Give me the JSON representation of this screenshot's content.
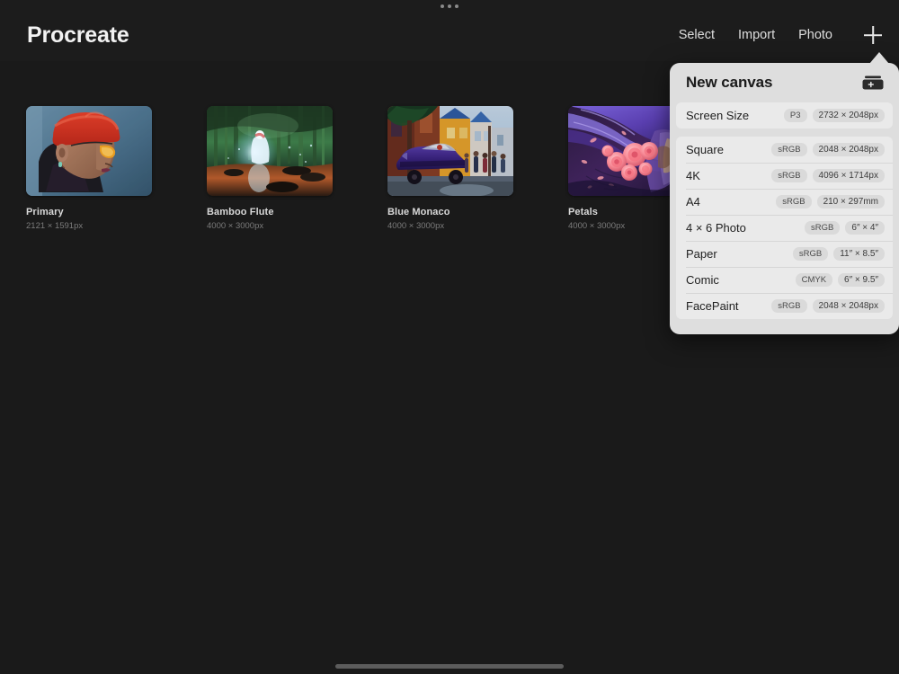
{
  "app": {
    "title": "Procreate",
    "multitask_dots": 3
  },
  "nav": {
    "items": [
      {
        "label": "Select",
        "name": "select"
      },
      {
        "label": "Import",
        "name": "import"
      },
      {
        "label": "Photo",
        "name": "photo"
      }
    ],
    "add_icon": "plus-icon"
  },
  "gallery": {
    "artworks": [
      {
        "title": "Primary",
        "dimensions": "2121 × 1591px",
        "art": "portrait-red-beanie"
      },
      {
        "title": "Bamboo Flute",
        "dimensions": "4000 × 3000px",
        "art": "bamboo-forest-spirit"
      },
      {
        "title": "Blue Monaco",
        "dimensions": "4000 × 3000px",
        "art": "purple-car-street"
      },
      {
        "title": "Petals",
        "dimensions": "4000 × 3000px",
        "art": "purple-hair-roses"
      }
    ]
  },
  "popover": {
    "title": "New canvas",
    "custom_canvas_icon": "canvas-plus-icon",
    "groups": [
      {
        "rows": [
          {
            "name": "Screen Size",
            "color_profile": "P3",
            "size": "2732 × 2048px"
          }
        ]
      },
      {
        "rows": [
          {
            "name": "Square",
            "color_profile": "sRGB",
            "size": "2048 × 2048px"
          },
          {
            "name": "4K",
            "color_profile": "sRGB",
            "size": "4096 × 1714px"
          },
          {
            "name": "A4",
            "color_profile": "sRGB",
            "size": "210 × 297mm"
          },
          {
            "name": "4 × 6 Photo",
            "color_profile": "sRGB",
            "size": "6″ × 4″"
          },
          {
            "name": "Paper",
            "color_profile": "sRGB",
            "size": "11″ × 8.5″"
          },
          {
            "name": "Comic",
            "color_profile": "CMYK",
            "size": "6″ × 9.5″"
          },
          {
            "name": "FacePaint",
            "color_profile": "sRGB",
            "size": "2048 × 2048px"
          }
        ]
      }
    ]
  },
  "system": {
    "home_indicator": "home-indicator"
  },
  "colors": {
    "background": "#1a1a1a",
    "topbar": "#1c1c1c",
    "popover_bg": "#dedede",
    "popover_row": "#eaeaea",
    "text_primary": "#f2f2f2",
    "text_secondary": "#7b7b7b"
  }
}
